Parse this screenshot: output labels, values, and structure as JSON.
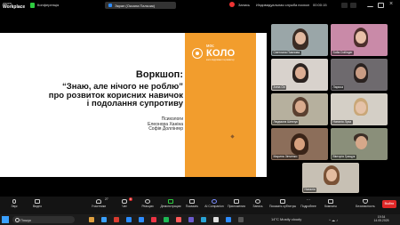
{
  "topbar": {
    "app_name_line1": "zoom",
    "app_name_line2": "Workplace",
    "meeting_label": "Конференція",
    "share_chip": "Экран (Оксана Пальчик)",
    "right_items": [
      "Запись",
      "Индивидуальная служба психологической",
      "00:00:15"
    ]
  },
  "slide": {
    "logo_top": "моє",
    "logo_main": "КОЛО",
    "logo_tagline": "коло підтримки та розвитку",
    "title": "Воркшоп:",
    "subtitle_lines": [
      "“Знаю, але нічого не роблю”",
      "про розвиток корисних навичок",
      "і подолання супротиву"
    ],
    "author_role": "Психологи",
    "authors": [
      "Елеонора Ханіна",
      "Софія Доллінгер"
    ]
  },
  "participants": [
    {
      "name": "Светлана Павлова"
    },
    {
      "name": "Sofia Dollinger"
    },
    {
      "name": "Анна Ол"
    },
    {
      "name": "Лариса"
    },
    {
      "name": "Людмила Шевчук"
    },
    {
      "name": "Наталія Лука"
    },
    {
      "name": "Марина Зінченко"
    },
    {
      "name": "Вікторія Грищук"
    },
    {
      "name": "Наталія"
    }
  ],
  "toolbar": {
    "items": [
      {
        "label": "Звук",
        "icon": "microphone-icon"
      },
      {
        "label": "Видео",
        "icon": "video-icon"
      },
      {
        "label": "Участники",
        "icon": "participants-icon",
        "count": "27"
      },
      {
        "label": "Чат",
        "icon": "chat-icon",
        "count": "8"
      },
      {
        "label": "Реакции",
        "icon": "reactions-icon"
      },
      {
        "label": "Демонстрация",
        "icon": "share-icon"
      },
      {
        "label": "Показать",
        "icon": "view-icon"
      },
      {
        "label": "AI Companion",
        "icon": "ai-icon"
      },
      {
        "label": "Приложения",
        "icon": "apps-icon"
      },
      {
        "label": "Запись",
        "icon": "record-icon"
      },
      {
        "label": "Показать субтитры",
        "icon": "captions-icon"
      },
      {
        "label": "Подробнее",
        "icon": "more-icon"
      },
      {
        "label": "Комнаты",
        "icon": "rooms-icon"
      },
      {
        "label": "Безопасность",
        "icon": "shield-icon"
      }
    ],
    "end_label": "Выйти"
  },
  "taskbar": {
    "search_placeholder": "Пошук",
    "weather": "14°C  Mostly cloudy",
    "time": "19:34",
    "date": "14.05.2025"
  },
  "colors": {
    "slide_accent": "#f29d2d",
    "end_button": "#e02828",
    "taskbar": "#1c1c1c"
  }
}
